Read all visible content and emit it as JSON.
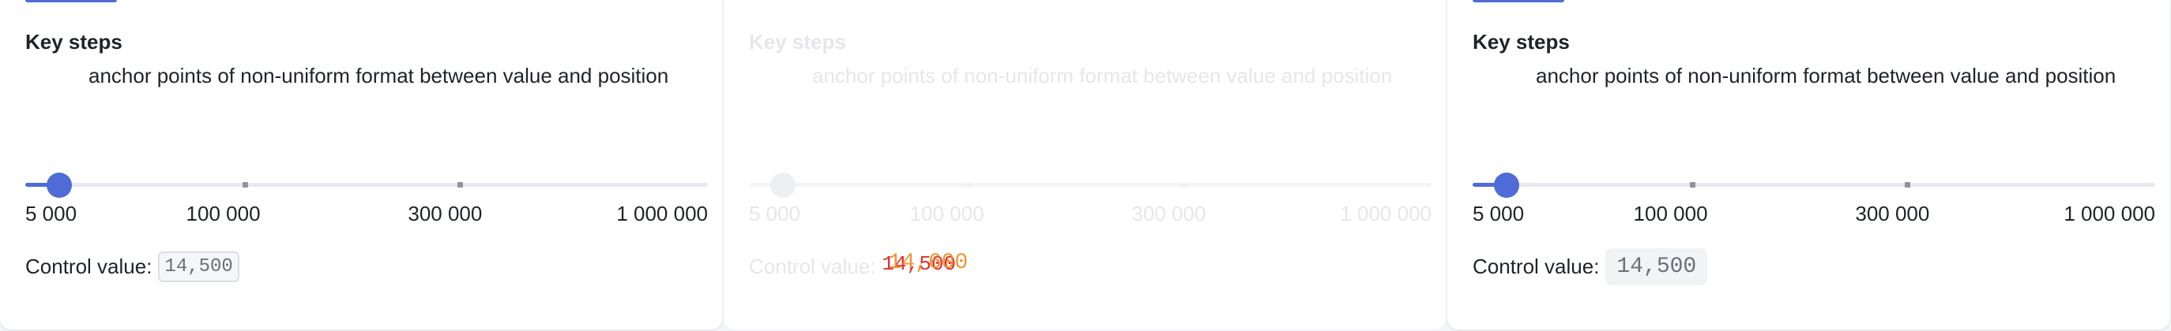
{
  "cards": [
    {
      "title": "Key steps",
      "description": "anchor points of non-uniform format between value and position",
      "marks": [
        "5 000",
        "100 000",
        "300 000",
        "1 000 000"
      ],
      "value_fraction": 0.05,
      "control_label": "Control value:",
      "control_value": "14,500",
      "state": "normal"
    },
    {
      "title": "Key steps",
      "description": "anchor points of non-uniform format between value and position",
      "marks": [
        "5 000",
        "100 000",
        "300 000",
        "1 000 000"
      ],
      "value_fraction": 0.05,
      "control_label": "Control value:",
      "control_value_old": "14,500",
      "control_value_new": "14,600",
      "state": "faded"
    },
    {
      "title": "Key steps",
      "description": "anchor points of non-uniform format between value and position",
      "marks": [
        "5 000",
        "100 000",
        "300 000",
        "1 000 000"
      ],
      "value_fraction": 0.05,
      "control_label": "Control value:",
      "control_value": "14,500",
      "state": "normal"
    }
  ],
  "colors": {
    "accent": "#4e6bd6",
    "text": "#1f2329",
    "rail": "#e8e9ed",
    "flash_old": "#e02f2f",
    "flash_new": "#ee8a1f"
  }
}
